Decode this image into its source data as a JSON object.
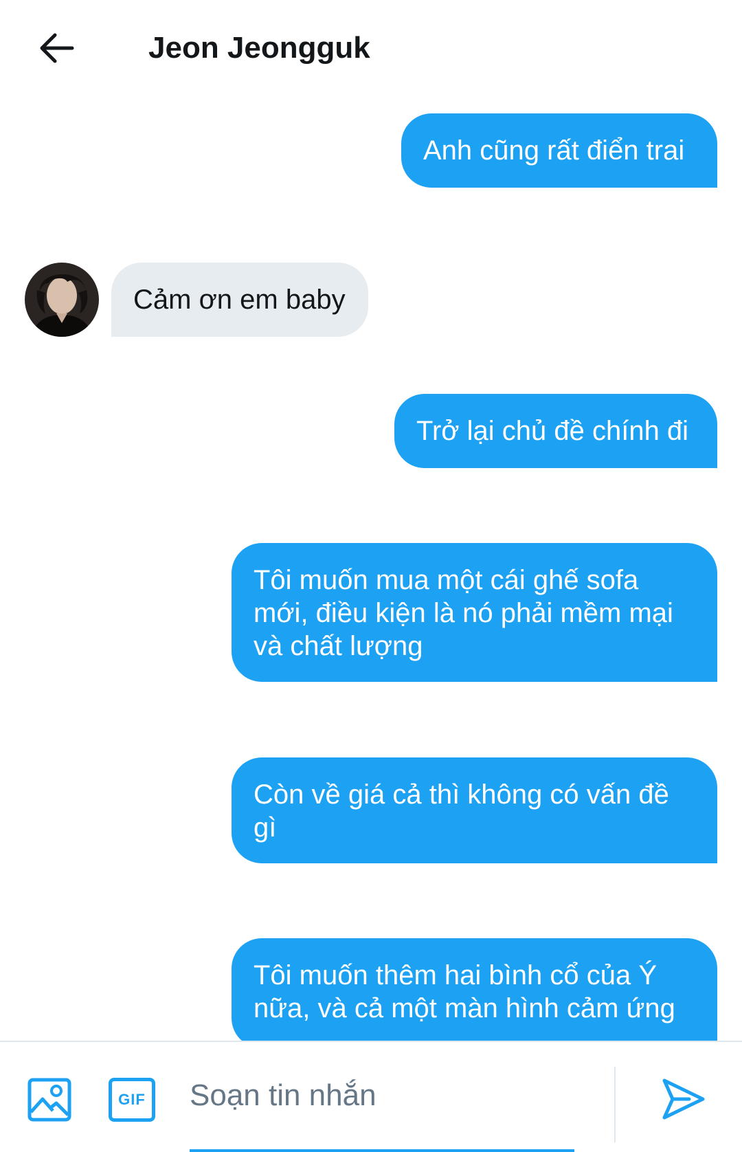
{
  "header": {
    "title": "Jeon Jeongguk",
    "back_icon": "arrow-left-icon"
  },
  "colors": {
    "accent": "#1da1f2",
    "received_bubble": "#e6ecf0",
    "text": "#14171a",
    "placeholder": "#657786"
  },
  "messages": [
    {
      "direction": "sent",
      "text": "Anh cũng rất điển trai"
    },
    {
      "direction": "received",
      "text": "Cảm ơn em baby"
    },
    {
      "direction": "sent",
      "text": "Trở lại chủ đề chính đi"
    },
    {
      "direction": "sent",
      "text": "Tôi muốn mua một cái ghế sofa mới, điều kiện là nó phải mềm mại và chất lượng"
    },
    {
      "direction": "sent",
      "text": "Còn về giá cả thì không có vấn đề gì"
    },
    {
      "direction": "sent",
      "text": "Tôi muốn thêm hai bình cổ của Ý nữa, và cả một màn hình cảm ứng"
    }
  ],
  "compose": {
    "placeholder": "Soạn tin nhắn",
    "image_icon": "image-icon",
    "gif_label": "GIF",
    "send_icon": "send-icon"
  }
}
